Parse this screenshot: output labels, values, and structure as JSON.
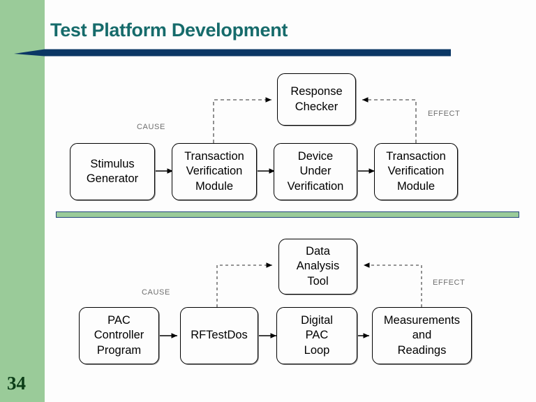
{
  "slide": {
    "title": "Test Platform Development",
    "page_number": "34",
    "colors": {
      "sidebar_green": "#9acb99",
      "title_teal": "#166b6b",
      "arrow_navy": "#0b3765",
      "divider_green": "#9acb99",
      "divider_border": "#23457d",
      "page_number_green": "#0b3d17",
      "flow_label_gray": "#6e6e6e",
      "node_border": "#000000",
      "node_fill": "#fdfdfd"
    }
  },
  "diagrams": [
    {
      "id": "verification-flow",
      "cause_label": "CAUSE",
      "effect_label": "EFFECT",
      "feedback_node": {
        "lines": [
          "Response",
          "Checker"
        ]
      },
      "chain": [
        {
          "lines": [
            "Stimulus",
            "Generator"
          ]
        },
        {
          "lines": [
            "Transaction",
            "Verification",
            "Module"
          ]
        },
        {
          "lines": [
            "Device",
            "Under",
            "Verification"
          ]
        },
        {
          "lines": [
            "Transaction",
            "Verification",
            "Module"
          ]
        }
      ]
    },
    {
      "id": "pac-test-flow",
      "cause_label": "CAUSE",
      "effect_label": "EFFECT",
      "feedback_node": {
        "lines": [
          "Data",
          "Analysis",
          "Tool"
        ]
      },
      "chain": [
        {
          "lines": [
            "PAC",
            "Controller",
            "Program"
          ]
        },
        {
          "lines": [
            "RFTestDos"
          ]
        },
        {
          "lines": [
            "Digital",
            "PAC",
            "Loop"
          ]
        },
        {
          "lines": [
            "Measurements",
            "and",
            "Readings"
          ]
        }
      ]
    }
  ]
}
